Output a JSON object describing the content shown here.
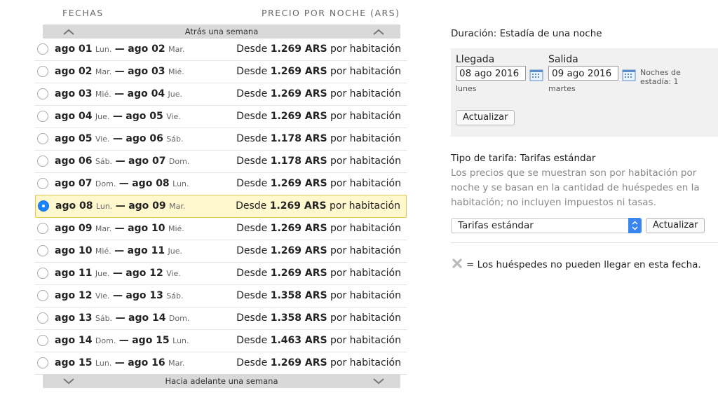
{
  "list": {
    "col_dates": "FECHAS",
    "col_price": "PRECIO POR NOCHE (ARS)",
    "prev_week": "Atrás una semana",
    "next_week": "Hacia adelante una semana",
    "selected_index": 7,
    "rows": [
      {
        "from": "ago 01",
        "from_dow": "Lun.",
        "to": "ago 02",
        "to_dow": "Mar.",
        "prefix": "Desde",
        "price": "1.269 ARS",
        "suffix": "por habitación"
      },
      {
        "from": "ago 02",
        "from_dow": "Mar.",
        "to": "ago 03",
        "to_dow": "Mié.",
        "prefix": "Desde",
        "price": "1.269 ARS",
        "suffix": "por habitación"
      },
      {
        "from": "ago 03",
        "from_dow": "Mié.",
        "to": "ago 04",
        "to_dow": "Jue.",
        "prefix": "Desde",
        "price": "1.269 ARS",
        "suffix": "por habitación"
      },
      {
        "from": "ago 04",
        "from_dow": "Jue.",
        "to": "ago 05",
        "to_dow": "Vie.",
        "prefix": "Desde",
        "price": "1.269 ARS",
        "suffix": "por habitación"
      },
      {
        "from": "ago 05",
        "from_dow": "Vie.",
        "to": "ago 06",
        "to_dow": "Sáb.",
        "prefix": "Desde",
        "price": "1.178 ARS",
        "suffix": "por habitación"
      },
      {
        "from": "ago 06",
        "from_dow": "Sáb.",
        "to": "ago 07",
        "to_dow": "Dom.",
        "prefix": "Desde",
        "price": "1.178 ARS",
        "suffix": "por habitación"
      },
      {
        "from": "ago 07",
        "from_dow": "Dom.",
        "to": "ago 08",
        "to_dow": "Lun.",
        "prefix": "Desde",
        "price": "1.269 ARS",
        "suffix": "por habitación"
      },
      {
        "from": "ago 08",
        "from_dow": "Lun.",
        "to": "ago 09",
        "to_dow": "Mar.",
        "prefix": "Desde",
        "price": "1.269 ARS",
        "suffix": "por habitación"
      },
      {
        "from": "ago 09",
        "from_dow": "Mar.",
        "to": "ago 10",
        "to_dow": "Mié.",
        "prefix": "Desde",
        "price": "1.269 ARS",
        "suffix": "por habitación"
      },
      {
        "from": "ago 10",
        "from_dow": "Mié.",
        "to": "ago 11",
        "to_dow": "Jue.",
        "prefix": "Desde",
        "price": "1.269 ARS",
        "suffix": "por habitación"
      },
      {
        "from": "ago 11",
        "from_dow": "Jue.",
        "to": "ago 12",
        "to_dow": "Vie.",
        "prefix": "Desde",
        "price": "1.269 ARS",
        "suffix": "por habitación"
      },
      {
        "from": "ago 12",
        "from_dow": "Vie.",
        "to": "ago 13",
        "to_dow": "Sáb.",
        "prefix": "Desde",
        "price": "1.358 ARS",
        "suffix": "por habitación"
      },
      {
        "from": "ago 13",
        "from_dow": "Sáb.",
        "to": "ago 14",
        "to_dow": "Dom.",
        "prefix": "Desde",
        "price": "1.358 ARS",
        "suffix": "por habitación"
      },
      {
        "from": "ago 14",
        "from_dow": "Dom.",
        "to": "ago 15",
        "to_dow": "Lun.",
        "prefix": "Desde",
        "price": "1.463 ARS",
        "suffix": "por habitación"
      },
      {
        "from": "ago 15",
        "from_dow": "Lun.",
        "to": "ago 16",
        "to_dow": "Mar.",
        "prefix": "Desde",
        "price": "1.269 ARS",
        "suffix": "por habitación"
      }
    ]
  },
  "stay": {
    "duration": "Duración: Estadía de una noche",
    "arrival_label": "Llegada",
    "arrival_value": "08 ago 2016",
    "arrival_day": "lunes",
    "departure_label": "Salida",
    "departure_value": "09 ago 2016",
    "departure_day": "martes",
    "nights_label": "Noches de estadía: 1",
    "update_label": "Actualizar"
  },
  "rate": {
    "title": "Tipo de tarifa: Tarifas estándar",
    "description": "Los precios que se muestran son por habitación por noche y se basan en la cantidad de huéspedes en la habitación; no incluyen impuestos ni tasas.",
    "selected": "Tarifas estándar",
    "update_label": "Actualizar"
  },
  "legend": {
    "icon": "x-icon",
    "text": "= Los huéspedes no pueden llegar en esta fecha."
  },
  "colors": {
    "selected_bg": "#fff8cf",
    "selected_border": "#e9c64d",
    "radio_on": "#1a82fb",
    "select_arrow": "#3a86f0"
  }
}
